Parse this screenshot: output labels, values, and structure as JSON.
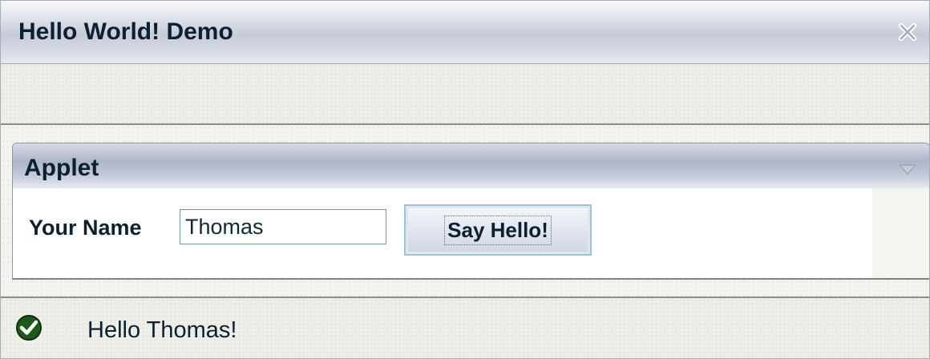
{
  "window": {
    "title": "Hello World! Demo",
    "close_icon": "close-icon"
  },
  "applet": {
    "title": "Applet",
    "collapse_icon": "triangle-down-icon",
    "name_label": "Your Name",
    "name_value": "Thomas",
    "button_label": "Say Hello!"
  },
  "status": {
    "icon": "check-icon",
    "message": "Hello Thomas!"
  },
  "colors": {
    "text": "#0c2130",
    "check_icon": "#1d5a1b"
  }
}
